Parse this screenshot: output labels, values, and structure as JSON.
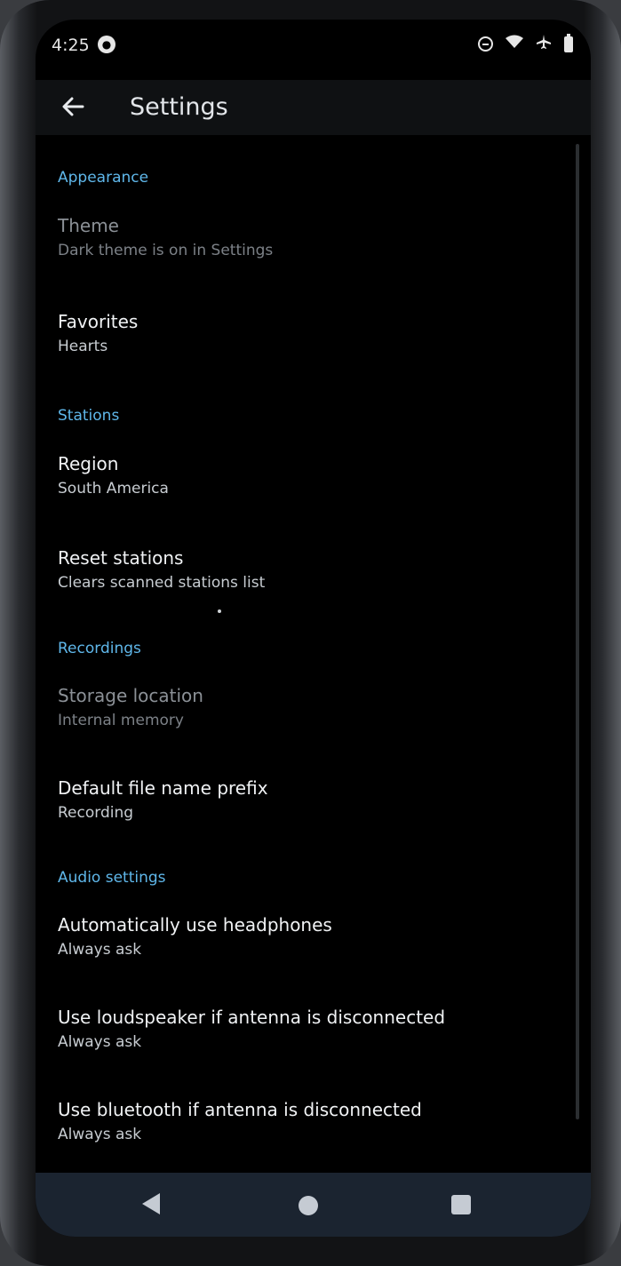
{
  "status_bar": {
    "time": "4:25",
    "icons": [
      "app-notification-icon",
      "do-not-disturb-icon",
      "wifi-icon",
      "airplane-mode-icon",
      "battery-icon"
    ]
  },
  "app_bar": {
    "back_icon": "arrow-back-icon",
    "title": "Settings"
  },
  "sections": {
    "appearance": {
      "title": "Appearance",
      "theme": {
        "primary": "Theme",
        "secondary": "Dark theme is on in Settings",
        "enabled": false
      },
      "favorites": {
        "primary": "Favorites",
        "secondary": "Hearts"
      }
    },
    "stations": {
      "title": "Stations",
      "region": {
        "primary": "Region",
        "secondary": "South America"
      },
      "reset": {
        "primary": "Reset stations",
        "secondary": "Clears scanned stations list"
      }
    },
    "recordings": {
      "title": "Recordings",
      "storage": {
        "primary": "Storage location",
        "secondary": "Internal memory",
        "enabled": false
      },
      "prefix": {
        "primary": "Default file name prefix",
        "secondary": "Recording"
      }
    },
    "audio": {
      "title": "Audio settings",
      "headphones": {
        "primary": "Automatically use headphones",
        "secondary": "Always ask"
      },
      "loudspeaker": {
        "primary": "Use loudspeaker if antenna is disconnected",
        "secondary": "Always ask"
      },
      "bluetooth": {
        "primary": "Use bluetooth if antenna is disconnected",
        "secondary": "Always ask"
      }
    }
  },
  "nav_bar": {
    "icons": [
      "back-icon",
      "home-icon",
      "recents-icon"
    ]
  },
  "colors": {
    "accent": "#5fb7ea",
    "background": "#000000",
    "nav_background": "#1b2430"
  }
}
